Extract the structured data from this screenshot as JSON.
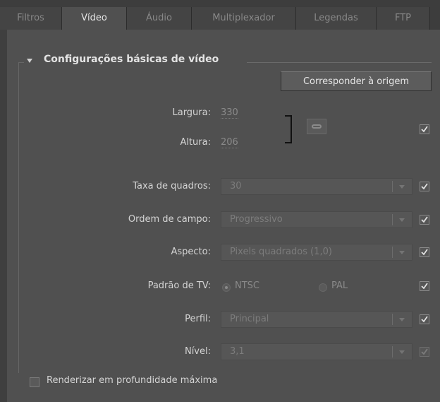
{
  "tabs": [
    {
      "label": "Filtros",
      "active": false
    },
    {
      "label": "Vídeo",
      "active": true
    },
    {
      "label": "Áudio",
      "active": false
    },
    {
      "label": "Multiplexador",
      "active": false
    },
    {
      "label": "Legendas",
      "active": false
    },
    {
      "label": "FTP",
      "active": false
    }
  ],
  "section": {
    "title": "Configurações básicas de vídeo",
    "match_button": "Corresponder à origem"
  },
  "dimensions": {
    "width_label": "Largura:",
    "width_value": "330",
    "height_label": "Altura:",
    "height_value": "206"
  },
  "fields": {
    "frame_rate": {
      "label": "Taxa de quadros:",
      "value": "30"
    },
    "field_order": {
      "label": "Ordem de campo:",
      "value": "Progressivo"
    },
    "aspect": {
      "label": "Aspecto:",
      "value": "Pixels quadrados (1,0)"
    },
    "tv_standard": {
      "label": "Padrão de TV:",
      "option1": "NTSC",
      "option2": "PAL"
    },
    "profile": {
      "label": "Perfil:",
      "value": "Principal"
    },
    "level": {
      "label": "Nível:",
      "value": "3,1"
    }
  },
  "render_max_depth": {
    "label": "Renderizar em profundidade máxima",
    "checked": false
  },
  "colors": {
    "panel": "#505050",
    "tabbar": "#3d3d3d",
    "text": "#d6d6d6",
    "disabled": "#7c7c7c"
  }
}
